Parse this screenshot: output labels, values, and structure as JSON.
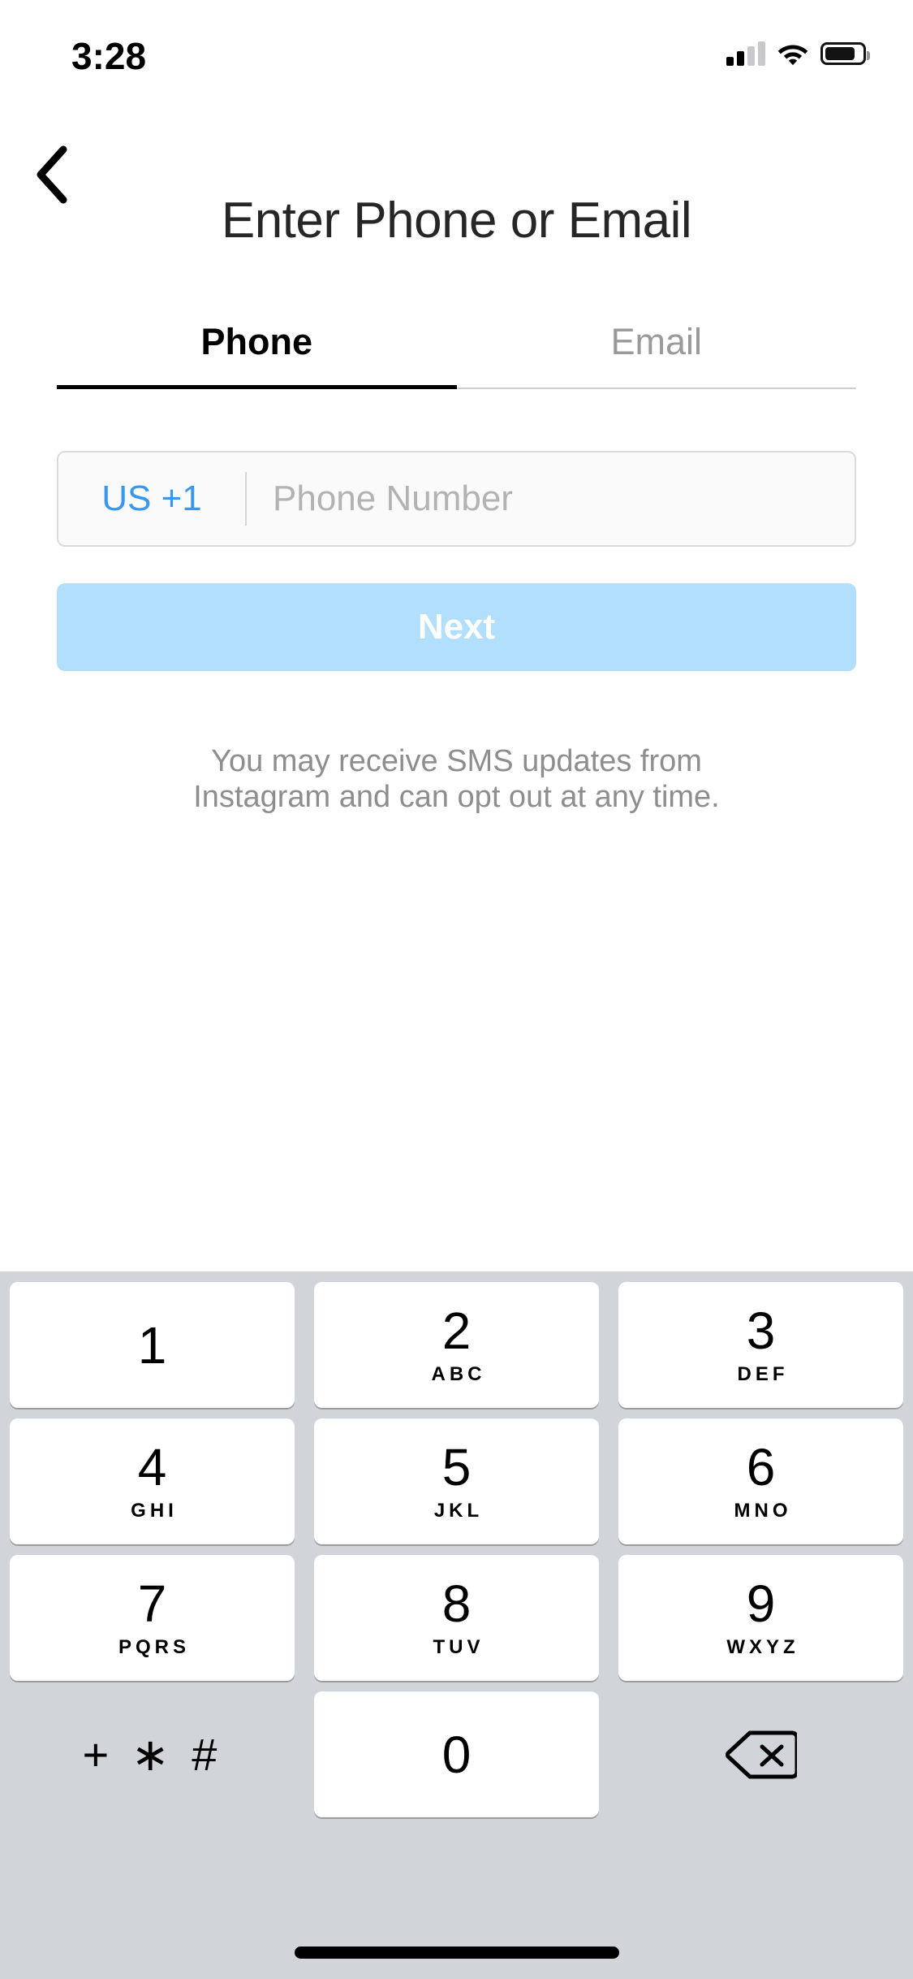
{
  "status_bar": {
    "time": "3:28",
    "cellular_icon": "cellular-signal-icon",
    "cellular_bars_filled": 2,
    "cellular_bars_total": 4,
    "wifi_icon": "wifi-icon",
    "battery_icon": "battery-icon",
    "battery_level_percent": 72
  },
  "nav": {
    "back_icon": "chevron-left-icon"
  },
  "header": {
    "title": "Enter Phone or Email"
  },
  "tabs": [
    {
      "label": "Phone",
      "active": true
    },
    {
      "label": "Email",
      "active": false
    }
  ],
  "phone_field": {
    "country_code": "US +1",
    "placeholder": "Phone Number",
    "value": ""
  },
  "next_button": {
    "label": "Next",
    "enabled": false,
    "color": "#b2dffc"
  },
  "sms_note": {
    "line1": "You may receive SMS updates from",
    "line2": "Instagram and can opt out at any time."
  },
  "keypad": {
    "background_color": "#d1d5da",
    "rows": [
      [
        {
          "digit": "1",
          "letters": "",
          "type": "key"
        },
        {
          "digit": "2",
          "letters": "ABC",
          "type": "key"
        },
        {
          "digit": "3",
          "letters": "DEF",
          "type": "key"
        }
      ],
      [
        {
          "digit": "4",
          "letters": "GHI",
          "type": "key"
        },
        {
          "digit": "5",
          "letters": "JKL",
          "type": "key"
        },
        {
          "digit": "6",
          "letters": "MNO",
          "type": "key"
        }
      ],
      [
        {
          "digit": "7",
          "letters": "PQRS",
          "type": "key"
        },
        {
          "digit": "8",
          "letters": "TUV",
          "type": "key"
        },
        {
          "digit": "9",
          "letters": "WXYZ",
          "type": "key"
        }
      ],
      [
        {
          "digit": "+ ∗ #",
          "letters": "",
          "type": "symbols",
          "icon": "plus-star-hash-icon"
        },
        {
          "digit": "0",
          "letters": "",
          "type": "key"
        },
        {
          "digit": "",
          "letters": "",
          "type": "backspace",
          "icon": "backspace-icon"
        }
      ]
    ]
  },
  "colors": {
    "accent_blue": "#3897f0",
    "next_blue": "#b2dffc",
    "text_primary": "#262626",
    "text_muted": "#8e8e8e",
    "keypad_bg": "#d1d5da"
  }
}
